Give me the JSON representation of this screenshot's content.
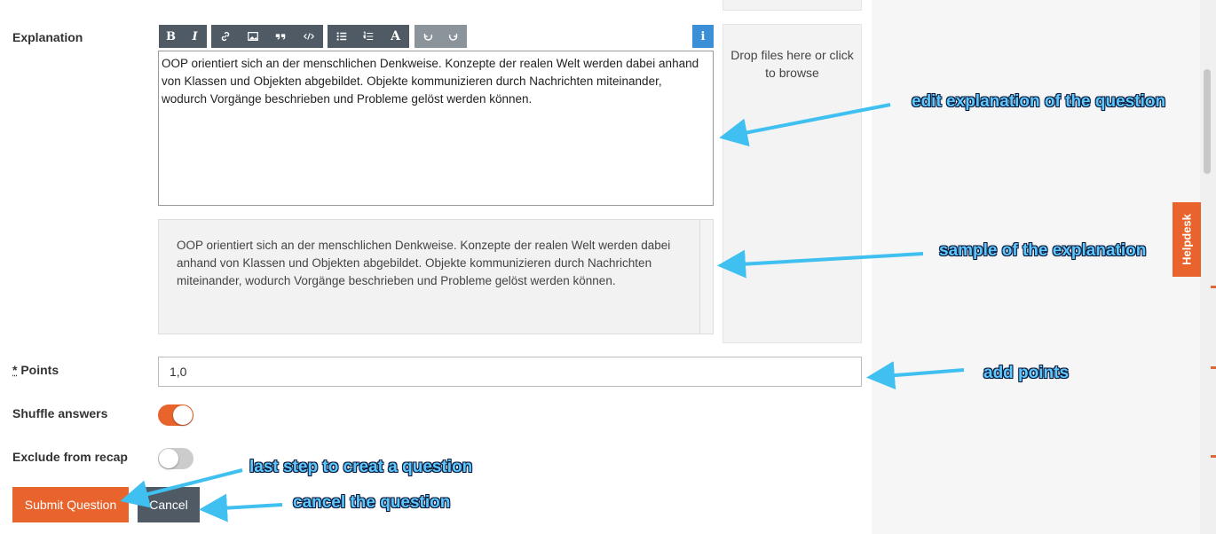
{
  "explanation": {
    "label": "Explanation",
    "text": "OOP orientiert sich an der menschlichen Denkweise. Konzepte der realen Welt werden dabei anhand von Klassen und Objekten abgebildet. Objekte kommunizieren durch Nachrichten miteinander, wodurch Vorgänge beschrieben und Probleme gelöst werden können.",
    "preview": "OOP orientiert sich an der menschlichen Denkweise. Konzepte der realen Welt werden dabei anhand von Klassen und Objekten abgebildet. Objekte kommunizieren durch Nachrichten miteinander, wodurch Vorgänge beschrieben und Probleme gelöst werden können."
  },
  "toolbar": {
    "bold": "B",
    "italic": "I",
    "heading": "A",
    "info": "i",
    "icons": [
      "link-icon",
      "image-icon",
      "quote-icon",
      "code-icon",
      "unordered-list-icon",
      "ordered-list-icon",
      "heading-icon",
      "undo-icon",
      "redo-icon",
      "info-icon"
    ]
  },
  "dropzone": {
    "text": "Drop files here or click to browse"
  },
  "points": {
    "required_marker": "*",
    "label": "Points",
    "value": "1,0"
  },
  "shuffle": {
    "label": "Shuffle answers",
    "on": true
  },
  "recap": {
    "label": "Exclude from recap",
    "on": false
  },
  "buttons": {
    "submit": "Submit Question",
    "cancel": "Cancel"
  },
  "helpdesk": {
    "label": "Helpdesk"
  },
  "annotations": {
    "edit": "edit explanation of the question",
    "sample": "sample of the explanation",
    "points": "add points",
    "submit": "last step to creat a question",
    "cancel": "cancel the question"
  },
  "colors": {
    "accent": "#e8642c",
    "toolbar": "#4f5a65",
    "info": "#3a8fd6",
    "cancel": "#4f5a65",
    "annotation": "#5cc8ff"
  }
}
